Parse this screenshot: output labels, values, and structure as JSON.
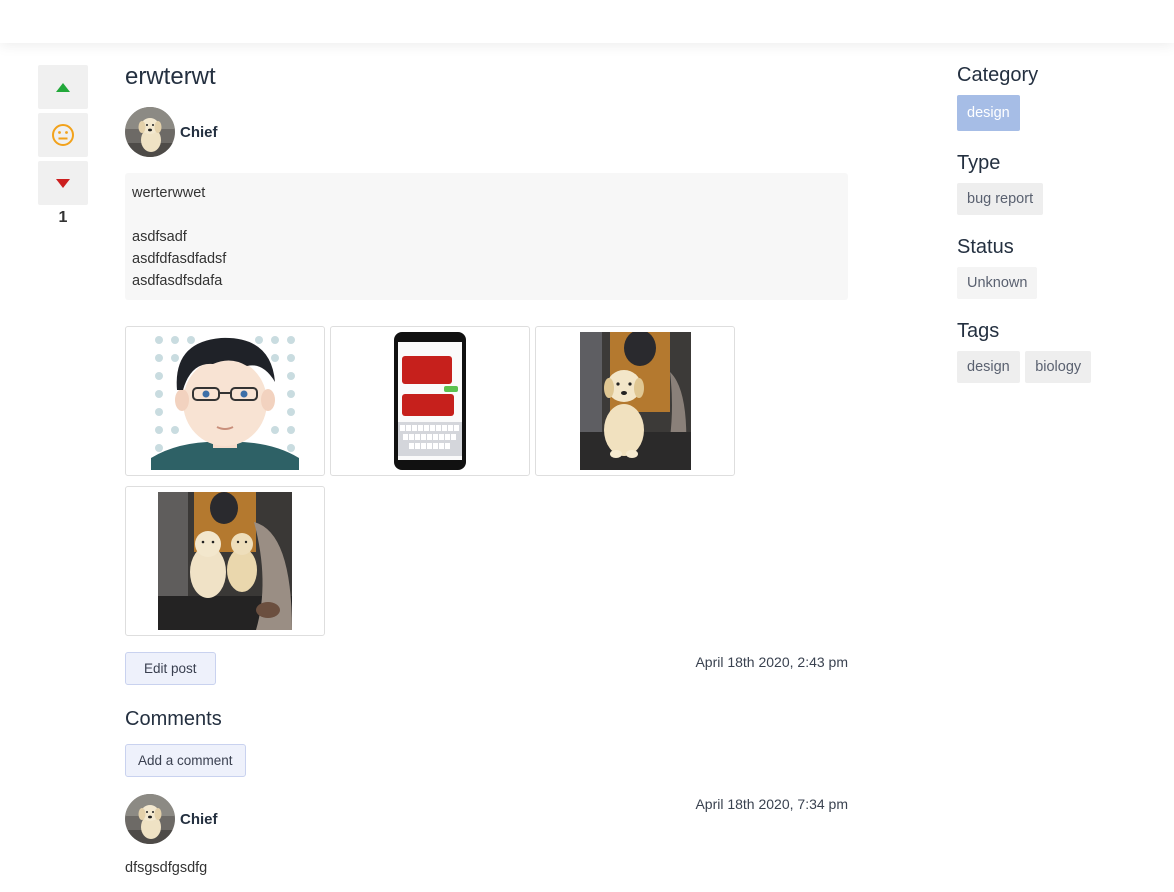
{
  "colors": {
    "upvote": "#22a83a",
    "downvote": "#cc1f1f",
    "neutral_face": "#f2a21b",
    "category_chip": "#a6bde6",
    "button_bg": "#eef1fb",
    "button_border": "#c9d2ef"
  },
  "votes": {
    "up_icon": "triangle-up-icon",
    "neutral_icon": "neutral-face-icon",
    "down_icon": "triangle-down-icon",
    "count": "1"
  },
  "post": {
    "title": "erwterwt",
    "author": "Chief",
    "body_lines": [
      "werterwwet",
      "",
      "asdfsadf",
      "asdfdfasdfadsf",
      "asdfasdfsdafa"
    ],
    "attachments": [
      "cartoon avatar",
      "phone screenshot",
      "puppy sitting",
      "two dogs"
    ],
    "edit_label": "Edit post",
    "timestamp": "April 18th 2020, 2:43 pm"
  },
  "comments": {
    "heading": "Comments",
    "add_label": "Add a comment",
    "items": [
      {
        "author": "Chief",
        "timestamp": "April 18th 2020, 7:34 pm",
        "text": "dfsgsdfgsdfg"
      }
    ]
  },
  "sidebar": {
    "category": {
      "heading": "Category",
      "value": "design"
    },
    "type": {
      "heading": "Type",
      "value": "bug report"
    },
    "status": {
      "heading": "Status",
      "value": "Unknown"
    },
    "tags": {
      "heading": "Tags",
      "values": [
        "design",
        "biology"
      ]
    }
  }
}
